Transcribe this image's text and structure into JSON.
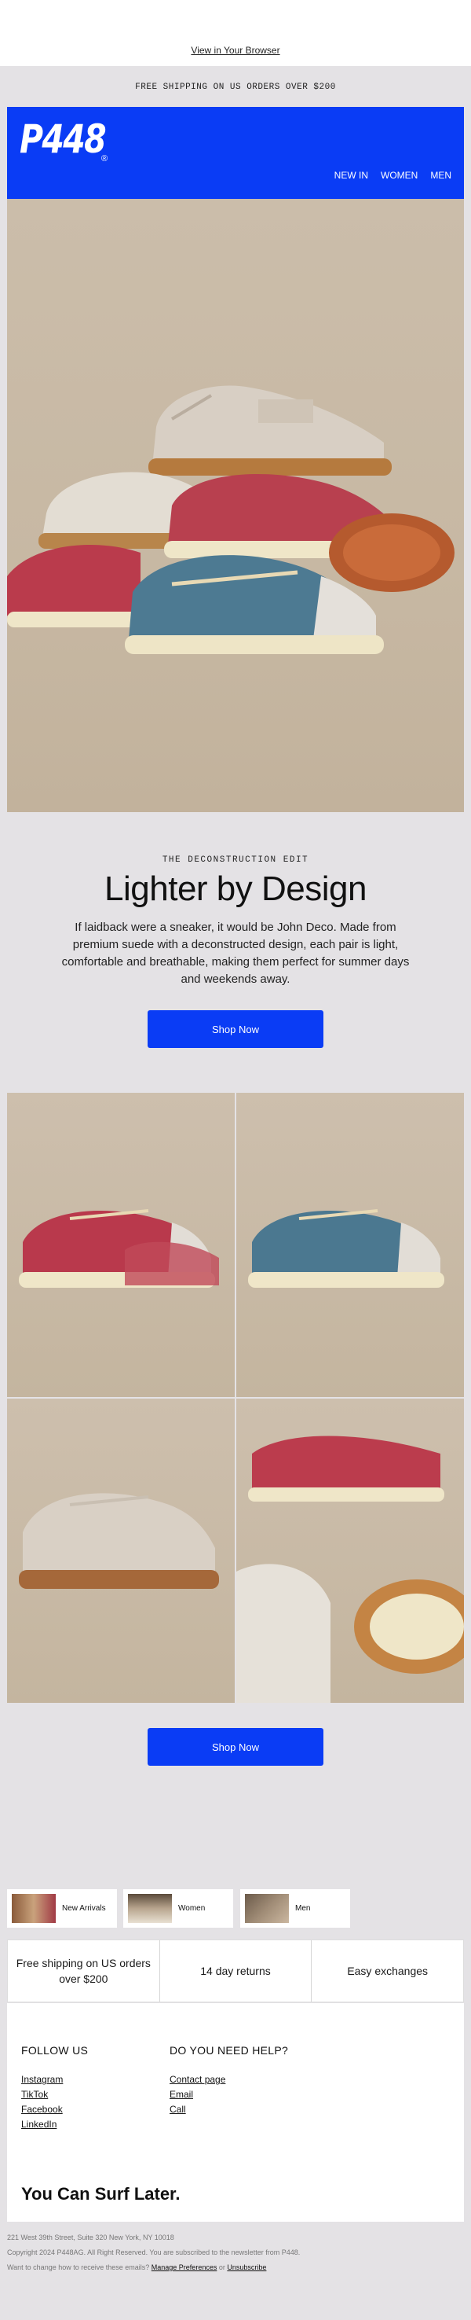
{
  "preheader": {
    "view_in_browser": "View in Your Browser"
  },
  "banner": {
    "shipping": "FREE SHIPPING ON US ORDERS OVER $200"
  },
  "header": {
    "logo": "P448",
    "logo_mark": "®",
    "nav": [
      "NEW IN",
      "WOMEN",
      "MEN"
    ],
    "color": "#0a3cf5"
  },
  "edit": {
    "kicker": "THE DECONSTRUCTION EDIT",
    "title": "Lighter by Design",
    "body": "If laidback were a sneaker, it would be John Deco. Made from premium suede with a deconstructed design, each pair is light, comfortable and breathable, making them perfect for summer days and weekends away.",
    "cta": "Shop Now"
  },
  "grid": {
    "cta": "Shop Now"
  },
  "categories": [
    "New Arrivals",
    "Women",
    "Men"
  ],
  "perks": [
    "Free shipping on US orders over $200",
    "14 day returns",
    "Easy exchanges"
  ],
  "footer": {
    "follow_heading": "FOLLOW US",
    "follow_links": [
      "Instagram",
      "TikTok",
      "Facebook",
      "LinkedIn"
    ],
    "help_heading": "DO YOU NEED HELP?",
    "help_links": [
      "Contact page",
      "Email",
      "Call"
    ],
    "tagline": "You Can Surf Later."
  },
  "fineprint": {
    "address": "221 West 39th Street, Suite 320 New York, NY 10018",
    "copyright": "Copyright 2024 P448AG. All Right Reserved. You are subscribed to the newsletter from P448.",
    "change_prefix": "Want to change how to receive these emails?",
    "manage": "Manage Preferences",
    "or": "or",
    "unsubscribe": "Unsubscribe"
  }
}
